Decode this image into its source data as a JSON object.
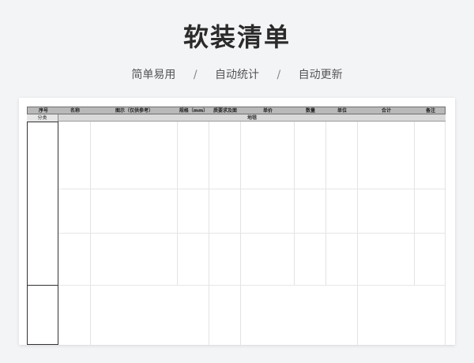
{
  "page": {
    "title": "软装清单",
    "subtitle_items": [
      "简单易用",
      "自动统计",
      "自动更新"
    ],
    "separator": "/"
  },
  "table": {
    "columns": [
      "序号",
      "名称",
      "图示（仅供参考）",
      "规格（mm）",
      "质要求及面",
      "单价",
      "数量",
      "单位",
      "合计",
      "备注"
    ],
    "category_label": "分类",
    "area_label": "地毯"
  }
}
